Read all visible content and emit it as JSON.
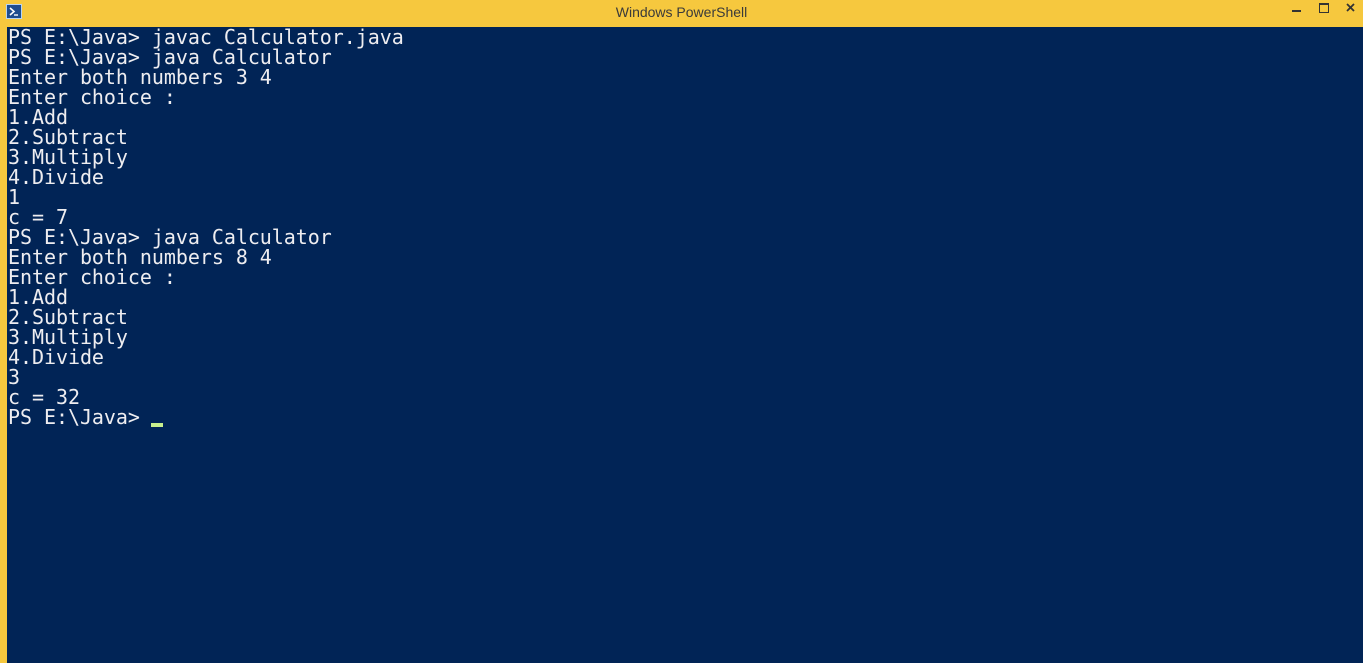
{
  "window": {
    "title": "Windows PowerShell",
    "icon": "powershell-icon",
    "controls": [
      "minimize-icon",
      "maximize-icon",
      "close-icon"
    ]
  },
  "colors": {
    "titlebar": "#f6c83e",
    "console_bg": "#012456",
    "console_fg": "#eeedf0",
    "cursor": "#c8f08e"
  },
  "console": {
    "lines": [
      "PS E:\\Java> javac Calculator.java",
      "PS E:\\Java> java Calculator",
      "Enter both numbers 3 4",
      "Enter choice :",
      "1.Add",
      "2.Subtract",
      "3.Multiply",
      "4.Divide",
      "1",
      "c = 7",
      "PS E:\\Java> java Calculator",
      "Enter both numbers 8 4",
      "Enter choice :",
      "1.Add",
      "2.Subtract",
      "3.Multiply",
      "4.Divide",
      "3",
      "c = 32",
      "PS E:\\Java> "
    ]
  }
}
